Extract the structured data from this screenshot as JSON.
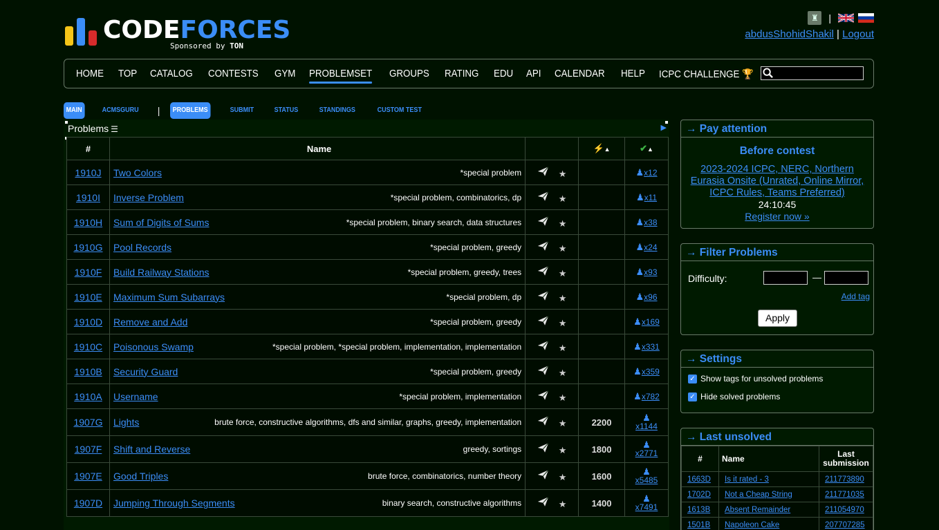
{
  "logo": {
    "word1": "CODE",
    "word2": "FORCES",
    "sponsored": "Sponsored by",
    "sponsor": "TON"
  },
  "user": {
    "name": "abdusShohidShakil",
    "divider": "|",
    "logout": "Logout"
  },
  "menu": [
    "HOME",
    "TOP",
    "CATALOG",
    "CONTESTS",
    "GYM",
    "PROBLEMSET",
    "GROUPS",
    "RATING",
    "EDU",
    "API",
    "CALENDAR",
    "HELP",
    "ICPC CHALLENGE"
  ],
  "menu_active": "PROBLEMSET",
  "submenu": {
    "main": "MAIN",
    "acmsguru": "ACMSGURU",
    "bar": "|",
    "problems": "PROBLEMS",
    "submit": "SUBMIT",
    "status": "STATUS",
    "standings": "STANDINGS",
    "custom": "CUSTOM TEST"
  },
  "problems": {
    "title": "Problems",
    "headers": {
      "id": "#",
      "name": "Name"
    },
    "rows": [
      {
        "id": "1910J",
        "name": "Two Colors",
        "tags": "*special problem",
        "diff": "",
        "solved": "x12"
      },
      {
        "id": "1910I",
        "name": "Inverse Problem",
        "tags": "*special problem, combinatorics, dp",
        "diff": "",
        "solved": "x11"
      },
      {
        "id": "1910H",
        "name": "Sum of Digits of Sums",
        "tags": "*special problem, binary search, data structures",
        "diff": "",
        "solved": "x38"
      },
      {
        "id": "1910G",
        "name": "Pool Records",
        "tags": "*special problem, greedy",
        "diff": "",
        "solved": "x24"
      },
      {
        "id": "1910F",
        "name": "Build Railway Stations",
        "tags": "*special problem, greedy, trees",
        "diff": "",
        "solved": "x93"
      },
      {
        "id": "1910E",
        "name": "Maximum Sum Subarrays",
        "tags": "*special problem, dp",
        "diff": "",
        "solved": "x96"
      },
      {
        "id": "1910D",
        "name": "Remove and Add",
        "tags": "*special problem, greedy",
        "diff": "",
        "solved": "x169"
      },
      {
        "id": "1910C",
        "name": "Poisonous Swamp",
        "tags": "*special problem, *special problem, implementation, implementation",
        "diff": "",
        "solved": "x331"
      },
      {
        "id": "1910B",
        "name": "Security Guard",
        "tags": "*special problem, greedy",
        "diff": "",
        "solved": "x359"
      },
      {
        "id": "1910A",
        "name": "Username",
        "tags": "*special problem, implementation",
        "diff": "",
        "solved": "x782"
      },
      {
        "id": "1907G",
        "name": "Lights",
        "tags": "brute force, constructive algorithms, dfs and similar, graphs, greedy, implementation",
        "diff": "2200",
        "solved": "x1144"
      },
      {
        "id": "1907F",
        "name": "Shift and Reverse",
        "tags": "greedy, sortings",
        "diff": "1800",
        "solved": "x2771"
      },
      {
        "id": "1907E",
        "name": "Good Triples",
        "tags": "brute force, combinatorics, number theory",
        "diff": "1600",
        "solved": "x5485"
      },
      {
        "id": "1907D",
        "name": "Jumping Through Segments",
        "tags": "binary search, constructive algorithms",
        "diff": "1400",
        "solved": "x7491"
      }
    ]
  },
  "pay_attention": {
    "title": "→ Pay attention",
    "sub": "Before contest",
    "contest": "2023-2024 ICPC, NERC, Northern Eurasia Onsite (Unrated, Online Mirror, ICPC Rules, Teams Preferred)",
    "timer": "24:10:45",
    "register": "Register now »"
  },
  "filter": {
    "title": "→ Filter Problems",
    "difficulty": "Difficulty:",
    "dash": "—",
    "add_tag": "Add tag",
    "apply": "Apply"
  },
  "settings": {
    "title": "→ Settings",
    "opt1": "Show tags for unsolved problems",
    "opt2": "Hide solved problems"
  },
  "last_unsolved": {
    "title": "→ Last unsolved",
    "headers": {
      "id": "#",
      "name": "Name",
      "last": "Last submission"
    },
    "rows": [
      {
        "id": "1663D",
        "name": "Is it rated - 3",
        "sub": "211773890"
      },
      {
        "id": "1702D",
        "name": "Not a Cheap String",
        "sub": "211771035"
      },
      {
        "id": "1613B",
        "name": "Absent Remainder",
        "sub": "211054970"
      },
      {
        "id": "1501B",
        "name": "Napoleon Cake",
        "sub": "207707285"
      }
    ]
  },
  "colors": {
    "background": "#001200",
    "accent": "#3b8df7"
  }
}
